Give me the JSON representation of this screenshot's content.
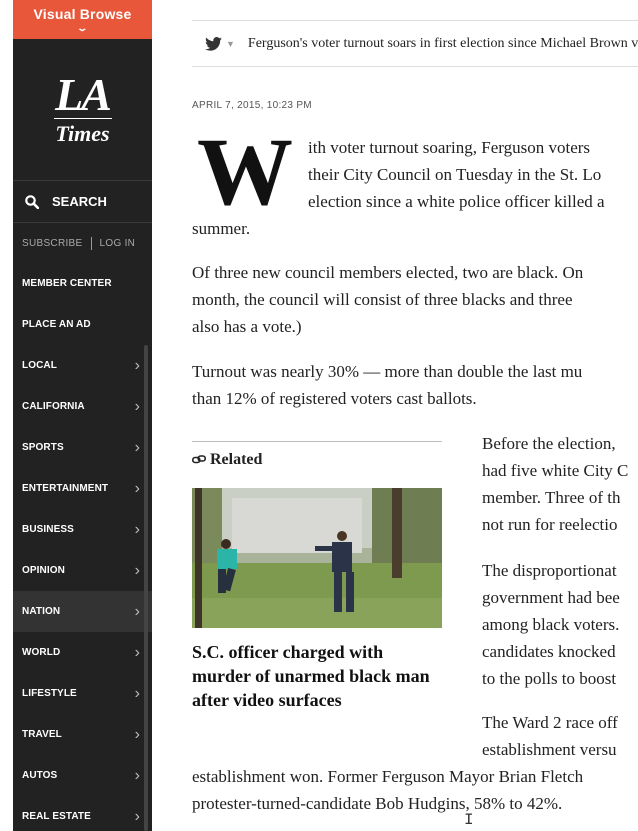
{
  "sidebar": {
    "visual_browse": "Visual Browse",
    "logo_la": "LA",
    "logo_times": "Times",
    "search_label": "SEARCH",
    "subscribe": "SUBSCRIBE",
    "login": "LOG IN",
    "items": [
      {
        "label": "MEMBER CENTER",
        "arrow": ""
      },
      {
        "label": "PLACE AN AD",
        "arrow": ""
      },
      {
        "label": "LOCAL",
        "arrow": "›"
      },
      {
        "label": "CALIFORNIA",
        "arrow": "›"
      },
      {
        "label": "SPORTS",
        "arrow": "›"
      },
      {
        "label": "ENTERTAINMENT",
        "arrow": "›"
      },
      {
        "label": "BUSINESS",
        "arrow": "›"
      },
      {
        "label": "OPINION",
        "arrow": "›"
      },
      {
        "label": "NATION",
        "arrow": "›"
      },
      {
        "label": "WORLD",
        "arrow": "›"
      },
      {
        "label": "LIFESTYLE",
        "arrow": "›"
      },
      {
        "label": "TRAVEL",
        "arrow": "›"
      },
      {
        "label": "AUTOS",
        "arrow": "›"
      },
      {
        "label": "REAL ESTATE",
        "arrow": "›"
      }
    ],
    "active_item": "NATION"
  },
  "share": {
    "headline": "Ferguson's voter turnout soars in first election since Michael Brown v"
  },
  "article": {
    "dateline": "APRIL 7, 2015, 10:23 PM",
    "dropcap": "W",
    "p1": [
      "ith voter turnout soaring, Ferguson voters",
      "their City Council on Tuesday in the St. Lo",
      "election since a white police officer killed a",
      "summer."
    ],
    "p2": [
      "Of three new council members elected, two are black. On",
      "month, the council will consist of three blacks and three",
      "also has a vote.)"
    ],
    "p3": [
      "Turnout was nearly 30% — more than double the last mu",
      "than 12% of registered voters cast ballots."
    ],
    "p4": [
      "Before the election,",
      "had five white City C",
      "member. Three of th",
      "not run for reelectio"
    ],
    "p5": [
      "The disproportionat",
      "government had bee",
      "among black voters.",
      "candidates knocked",
      "to the polls to boost"
    ],
    "p6": [
      "The Ward 2 race off",
      "establishment versu"
    ],
    "p6_full": [
      "establishment won. Former Ferguson Mayor Brian Fletch",
      "protester-turned-candidate Bob Hudgins, 58% to 42%."
    ]
  },
  "related": {
    "label": "Related",
    "headline": "S.C. officer charged with murder of unarmed black man after video surfaces"
  }
}
